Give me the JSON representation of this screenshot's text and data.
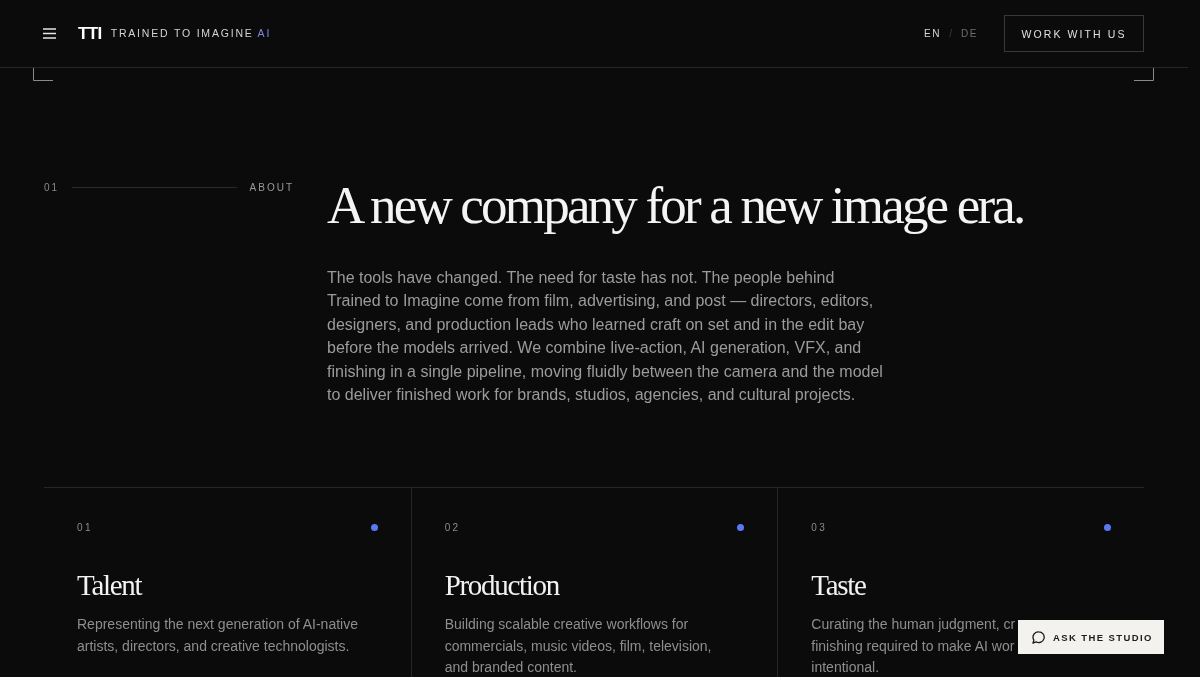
{
  "header": {
    "logo": "TTI",
    "brand": "TRAINED TO IMAGINE",
    "brand_suffix": "AI",
    "languages": [
      {
        "label": "EN",
        "selected": true
      },
      {
        "label": "DE",
        "selected": false
      }
    ],
    "language_separator": "/",
    "cta": "WORK WITH US"
  },
  "section": {
    "number": "01",
    "label": "ABOUT",
    "heading": "A new company for a new image era.",
    "body": "The tools have changed. The need for taste has not. The people behind Trained to Imagine come from film, advertising, and post — directors, editors, designers, and production leads who learned craft on set and in the edit bay before the models arrived. We combine live-action, AI generation, VFX, and finishing in a single pipeline, moving fluidly between the camera and the model to deliver finished work for brands, studios, agencies, and cultural projects."
  },
  "cards": [
    {
      "number": "01",
      "title": "Talent",
      "description": "Representing the next generation of AI-native\nartists, directors, and creative technologists."
    },
    {
      "number": "02",
      "title": "Production",
      "description": "Building scalable creative workflows for\ncommercials, music videos, film, television,\nand branded content."
    },
    {
      "number": "03",
      "title": "Taste",
      "description": "Curating the human judgment, cr\nfinishing required to make AI wor\nintentional."
    }
  ],
  "chat_button": {
    "label": "ASK THE STUDIO"
  }
}
